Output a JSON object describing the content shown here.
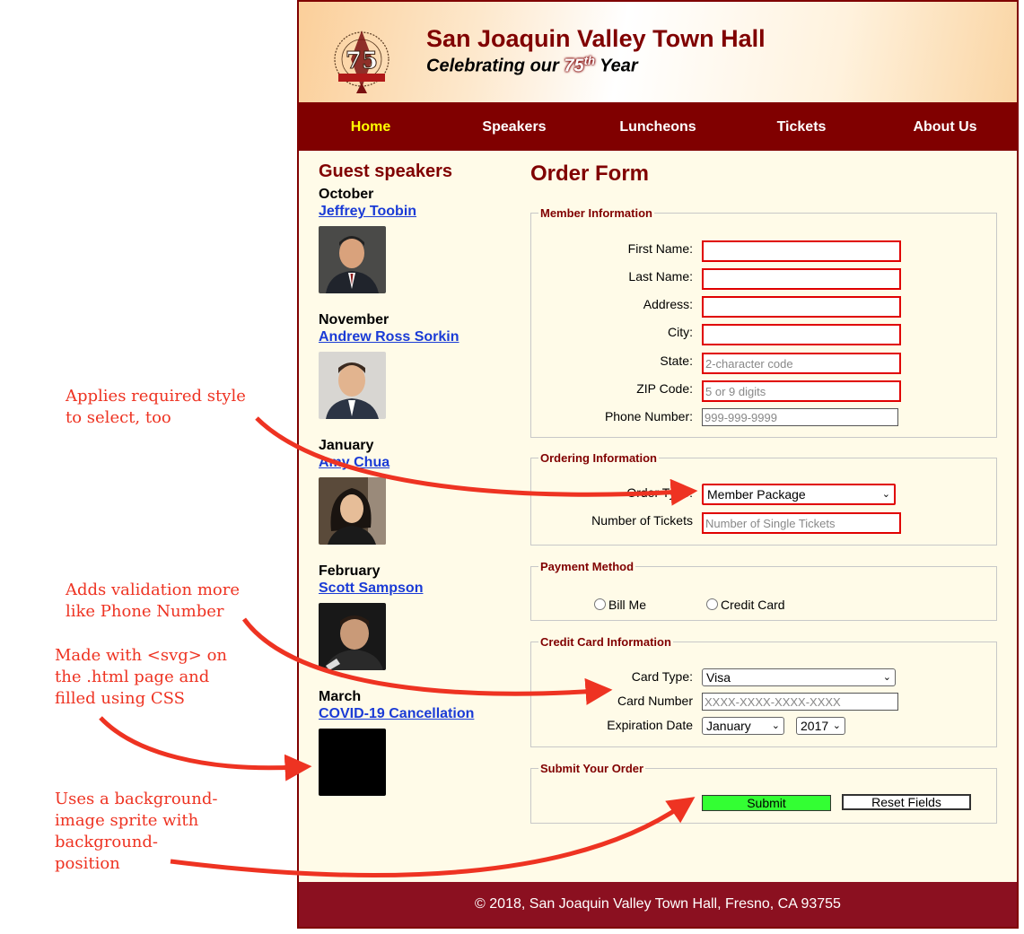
{
  "header": {
    "title": "San Joaquin Valley Town Hall",
    "subtitle_prefix": "Celebrating our ",
    "subtitle_number": "75",
    "subtitle_suffix_sup": "th",
    "subtitle_end": " Year",
    "logo_icon": "seal-75-anniversary-logo"
  },
  "nav": {
    "items": [
      "Home",
      "Speakers",
      "Luncheons",
      "Tickets",
      "About Us"
    ],
    "current": "Home",
    "current_color": "#ffff00"
  },
  "sidebar": {
    "heading": "Guest speakers",
    "speakers": [
      {
        "month": "October",
        "name": "Jeffrey Toobin"
      },
      {
        "month": "November",
        "name": "Andrew Ross Sorkin"
      },
      {
        "month": "January",
        "name": "Amy Chua"
      },
      {
        "month": "February",
        "name": "Scott Sampson"
      },
      {
        "month": "March",
        "name": "COVID-19 Cancellation"
      }
    ]
  },
  "form": {
    "title": "Order Form",
    "member": {
      "legend": "Member Information",
      "first_name_label": "First Name:",
      "last_name_label": "Last Name:",
      "address_label": "Address:",
      "city_label": "City:",
      "state_label": "State:",
      "state_placeholder": "2-character code",
      "zip_label": "ZIP Code:",
      "zip_placeholder": "5 or 9 digits",
      "phone_label": "Phone Number:",
      "phone_placeholder": "999-999-9999"
    },
    "ordering": {
      "legend": "Ordering Information",
      "order_type_label": "Order Type:",
      "order_type_value": "Member Package",
      "tickets_label": "Number of Tickets",
      "tickets_placeholder": "Number of Single Tickets"
    },
    "payment": {
      "legend": "Payment Method",
      "option_bill": "Bill Me",
      "option_card": "Credit Card"
    },
    "card": {
      "legend": "Credit Card Information",
      "type_label": "Card Type:",
      "type_value": "Visa",
      "number_label": "Card Number",
      "number_placeholder": "XXXX-XXXX-XXXX-XXXX",
      "expiration_label": "Expiration Date",
      "month_value": "January",
      "year_value": "2017"
    },
    "submit": {
      "legend": "Submit Your Order",
      "submit_label": "Submit",
      "reset_label": "Reset Fields"
    }
  },
  "footer": {
    "text": "© 2018, San Joaquin Valley Town Hall, Fresno, CA 93755"
  },
  "annotations": {
    "required_select": [
      "Applies required style",
      "to select, too"
    ],
    "validation": [
      "Adds validation more",
      "like Phone Number"
    ],
    "svg_note": [
      "Made with <svg> on",
      "the .html page and",
      "filled using CSS"
    ],
    "sprite_note": [
      "Uses a background-",
      "image sprite with",
      "background-",
      "position"
    ],
    "color": "#ee3322"
  }
}
